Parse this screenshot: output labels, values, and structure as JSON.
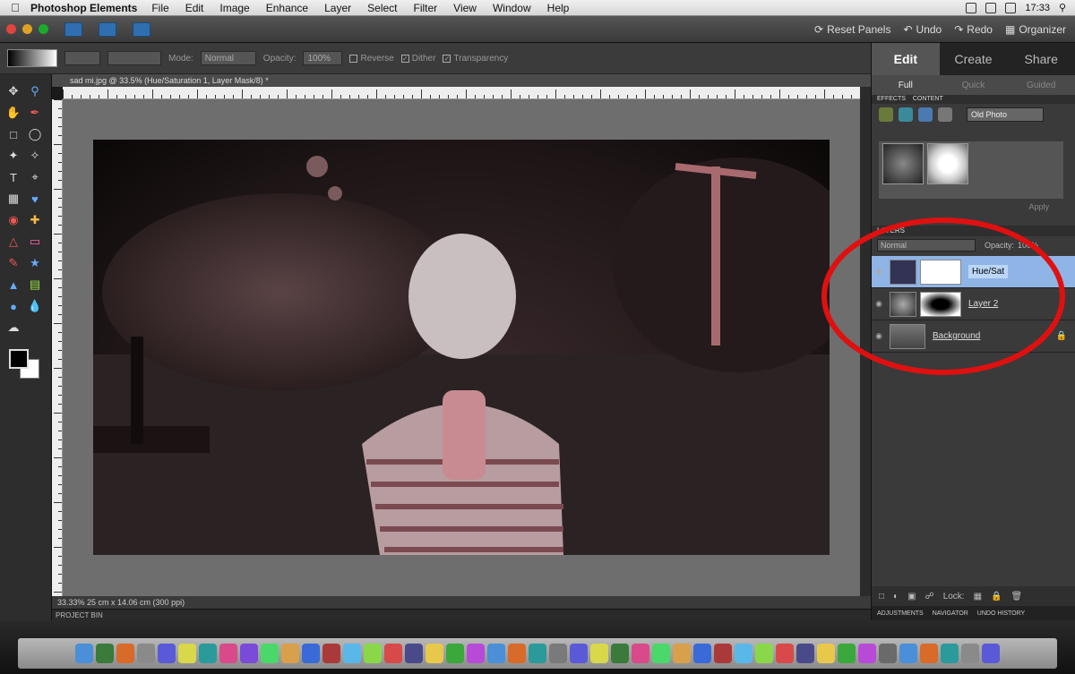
{
  "menubar": {
    "apple": "",
    "app_name": "Photoshop Elements",
    "items": [
      "File",
      "Edit",
      "Image",
      "Enhance",
      "Layer",
      "Select",
      "Filter",
      "View",
      "Window",
      "Help"
    ],
    "clock": "17:33"
  },
  "titlebar": {
    "reset_panels": "Reset Panels",
    "undo": "Undo",
    "redo": "Redo",
    "organizer": "Organizer"
  },
  "options": {
    "mode_label": "Mode:",
    "mode_value": "Normal",
    "opacity_label": "Opacity:",
    "opacity_value": "100%",
    "reverse": "Reverse",
    "dither": "Dither",
    "transparency": "Transparency"
  },
  "document": {
    "tab_title": "sad mi.jpg @ 33.5% (Hue/Saturation 1, Layer Mask/8) *",
    "status": "33.33%    25 cm x 14.06 cm (300 ppi)",
    "project_bin": "PROJECT BIN"
  },
  "panel": {
    "tabs": [
      "Edit",
      "Create",
      "Share"
    ],
    "subtabs": [
      "Full",
      "Quick",
      "Guided"
    ],
    "effects_header": "EFFECTS",
    "content_header": "CONTENT",
    "effects_select": "Old Photo",
    "apply": "Apply",
    "layers_header": "LAYERS",
    "blend_mode": "Normal",
    "opacity_label": "Opacity:",
    "opacity_value": "100%",
    "layers": [
      {
        "name": "Hue/Sat",
        "selected": true
      },
      {
        "name": "Layer 2",
        "selected": false
      },
      {
        "name": "Background",
        "selected": false
      }
    ],
    "lock_label": "Lock:",
    "footer": [
      "ADJUSTMENTS",
      "NAVIGATOR",
      "UNDO HISTORY"
    ]
  },
  "colors": {
    "annotation_circle": "#e01010",
    "accent": "#2f6fb0"
  }
}
